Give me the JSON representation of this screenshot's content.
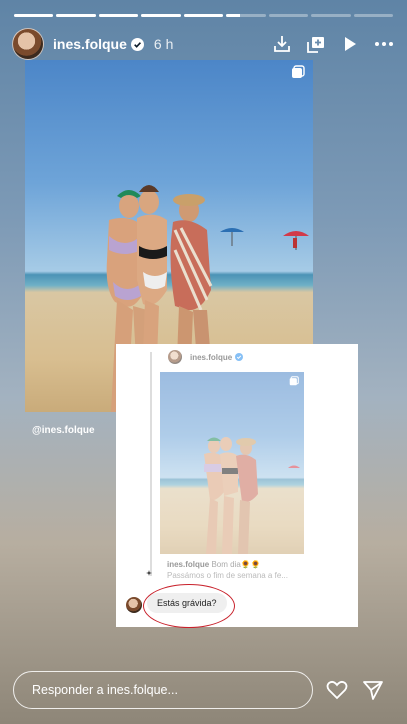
{
  "progress": [
    1,
    1,
    1,
    1,
    1,
    0.35,
    0,
    0,
    0
  ],
  "header": {
    "username": "ines.folque",
    "time": "6 h",
    "icons": [
      "download-icon",
      "add-to-story-icon",
      "play-icon",
      "more-icon"
    ]
  },
  "photo_tag": "@ines.folque",
  "shared_post": {
    "username": "ines.folque",
    "caption_greeting": "Bom dia🌻🌻",
    "caption_line2": "Passámos o fim de semana a fe..."
  },
  "reply": {
    "text": "Estás grávida?"
  },
  "footer": {
    "placeholder": "Responder a ines.folque..."
  },
  "colors": {
    "highlight_circle": "#c8202a",
    "verified_badge": "#3897f0"
  }
}
